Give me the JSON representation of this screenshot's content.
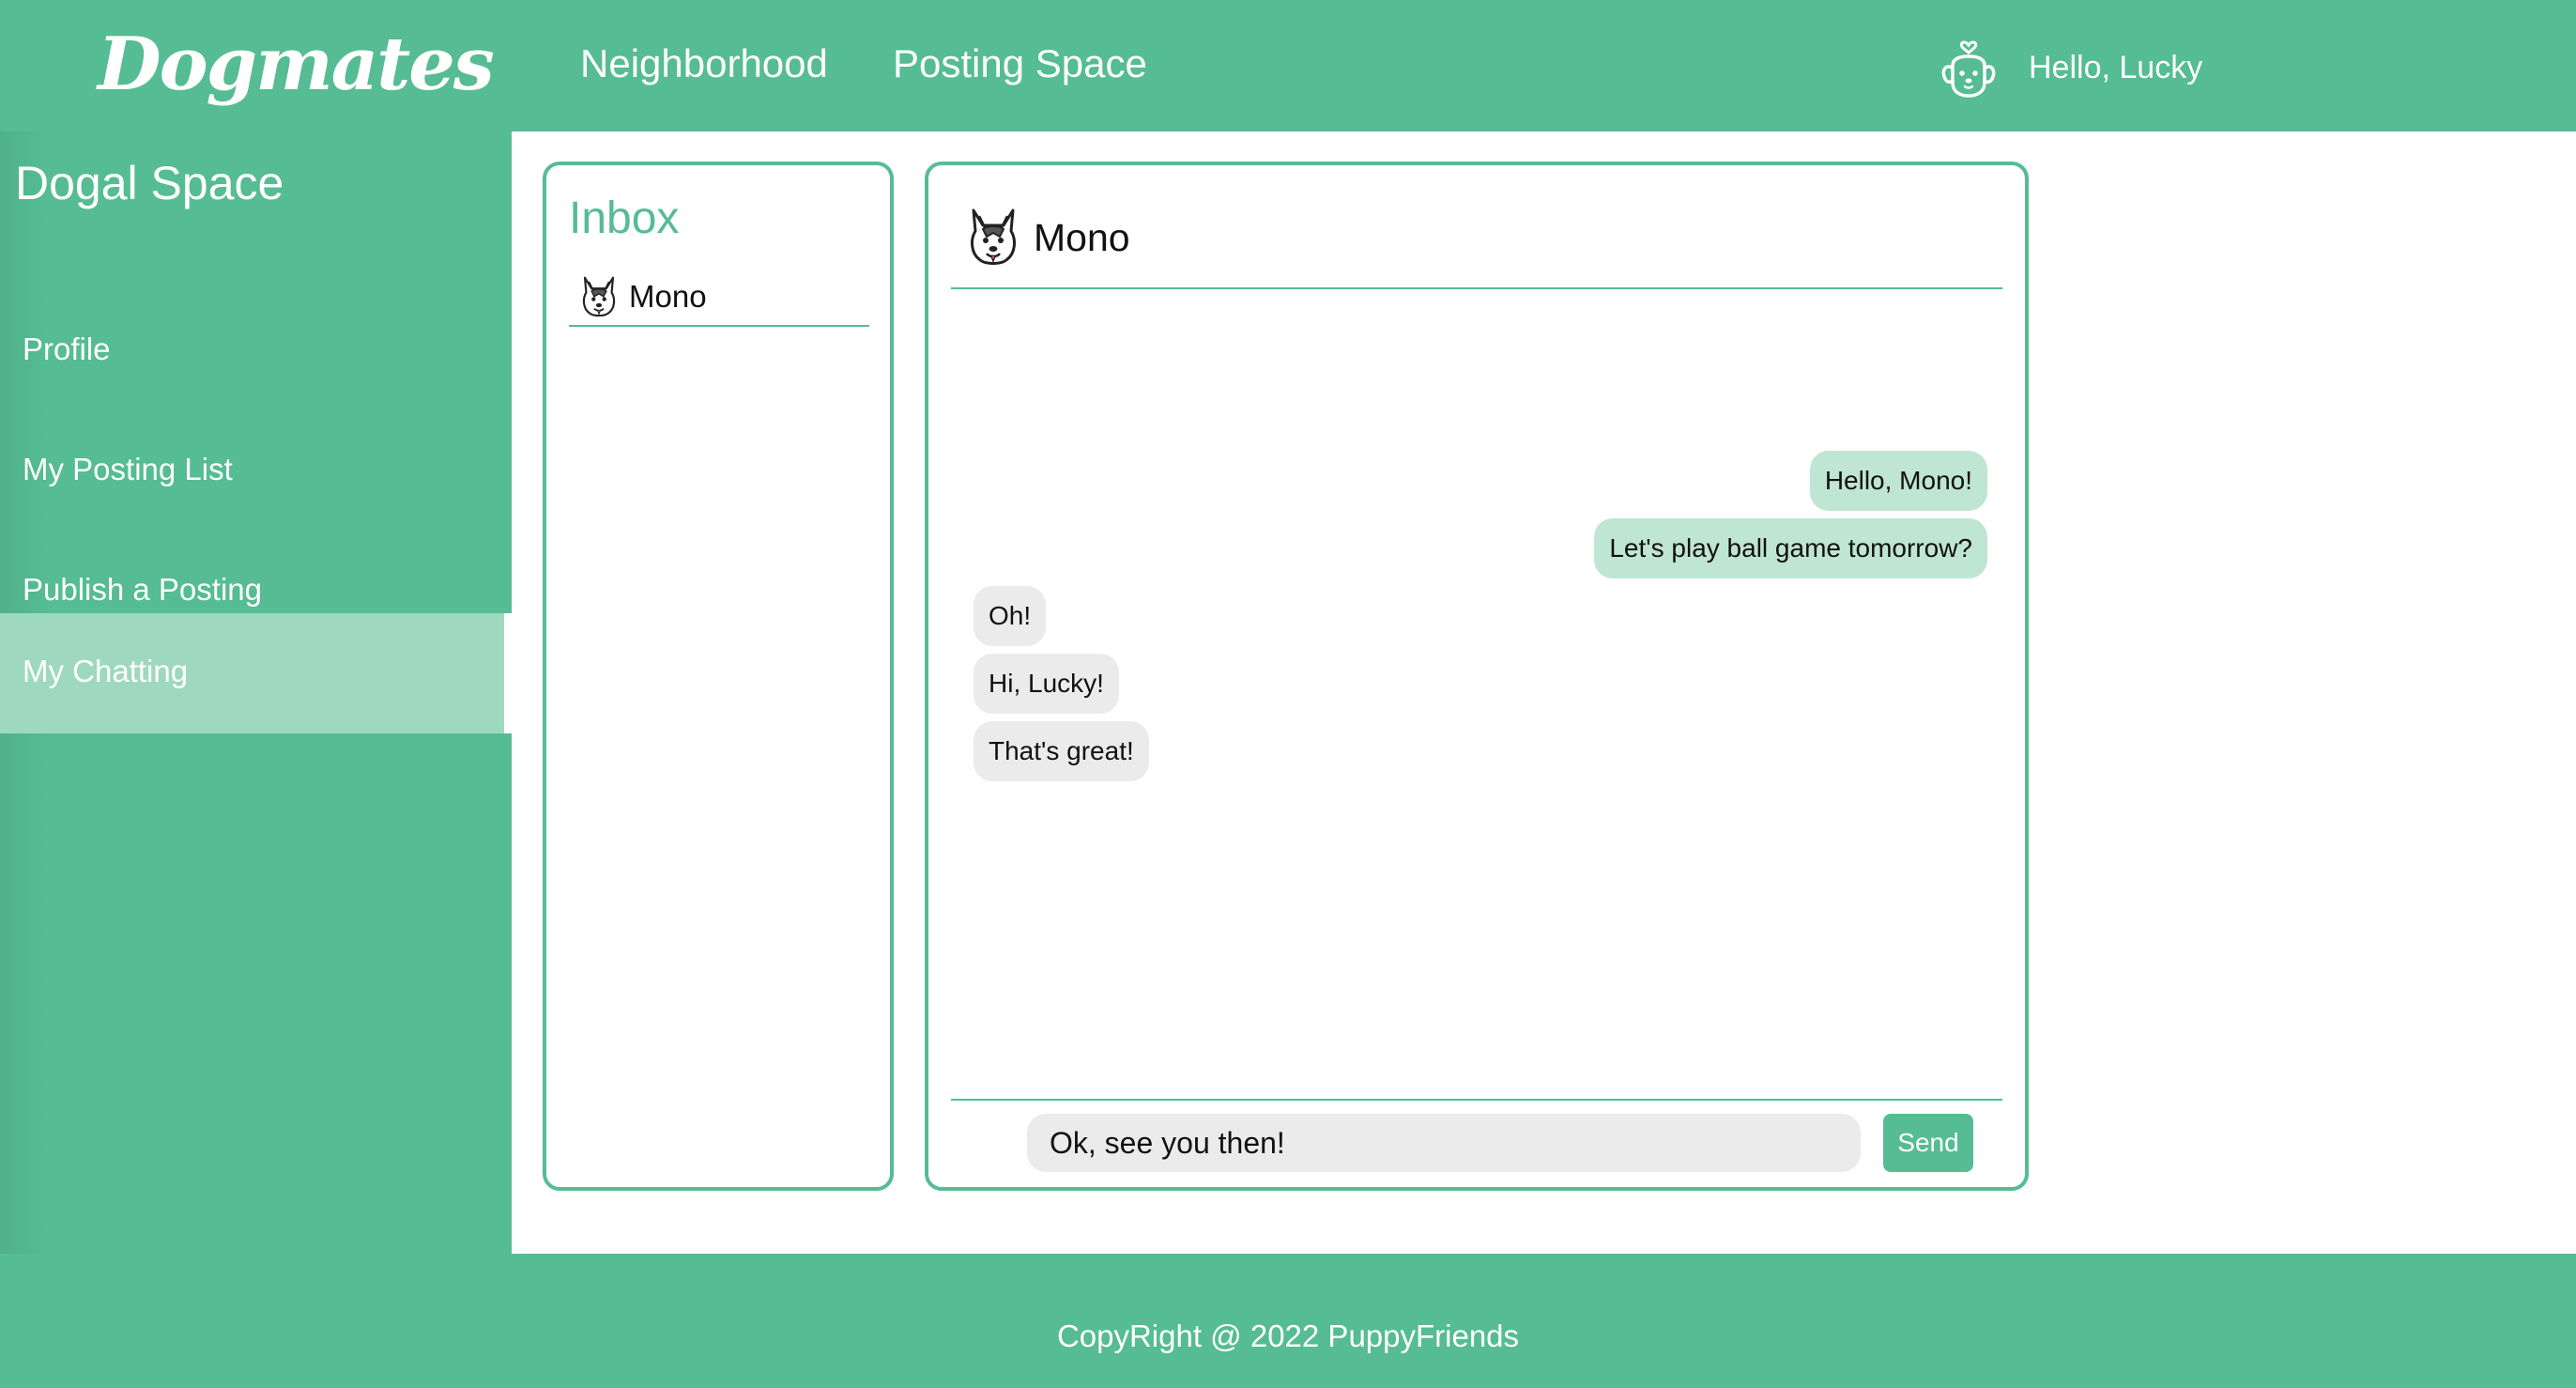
{
  "header": {
    "logo": "Dogmates",
    "nav": [
      "Neighborhood",
      "Posting Space"
    ],
    "user_icon": "dog-face-icon",
    "greeting": "Hello, Lucky"
  },
  "sidebar": {
    "title": "Dogal Space",
    "items": [
      {
        "label": "Profile"
      },
      {
        "label": "My Posting List"
      },
      {
        "label": "Publish a Posting"
      },
      {
        "label": "My Chatting",
        "active": true
      }
    ]
  },
  "inbox": {
    "title": "Inbox",
    "contacts": [
      {
        "name": "Mono",
        "avatar": "husky-icon"
      }
    ]
  },
  "chat": {
    "contact_name": "Mono",
    "contact_avatar": "husky-icon",
    "messages": [
      {
        "from": "me",
        "text": "Hello, Mono!"
      },
      {
        "from": "me",
        "text": "Let's play ball game tomorrow?"
      },
      {
        "from": "them",
        "text": "Oh!"
      },
      {
        "from": "them",
        "text": "Hi, Lucky!"
      },
      {
        "from": "them",
        "text": "That's great!"
      }
    ],
    "input_value": "Ok, see you then!",
    "send_label": "Send"
  },
  "footer": {
    "text": "CopyRight @ 2022 PuppyFriends"
  },
  "colors": {
    "brand": "#55bc93",
    "active_sidebar": "#9ed8bf",
    "my_bubble": "#bfe5d3",
    "their_bubble": "#ebebeb"
  }
}
